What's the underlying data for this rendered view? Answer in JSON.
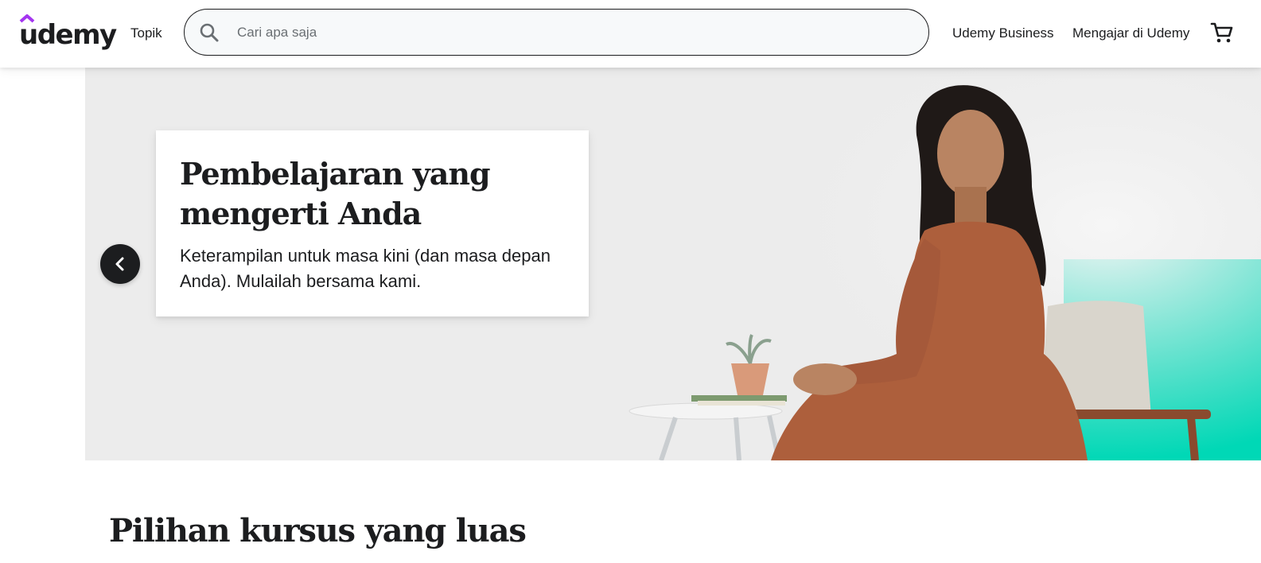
{
  "header": {
    "logo_text": "udemy",
    "topics_label": "Topik",
    "search": {
      "placeholder": "Cari apa saja",
      "value": ""
    },
    "business_label": "Udemy Business",
    "teach_label": "Mengajar di Udemy",
    "icons": {
      "search": "search-icon",
      "cart": "cart-icon",
      "logo_mark": "udemy-logo-mark"
    }
  },
  "hero": {
    "title": "Pembelajaran yang mengerti Anda",
    "subtitle": "Keterampilan untuk masa kini (dan masa depan Anda). Mulailah bersama kami.",
    "prev_icon": "chevron-left-icon",
    "colors": {
      "background": "#ececec",
      "accent_teal": "#00d8b6"
    }
  },
  "section": {
    "title": "Pilihan kursus yang luas"
  },
  "colors": {
    "brand_purple": "#a435f0",
    "text": "#1c1d1f"
  }
}
